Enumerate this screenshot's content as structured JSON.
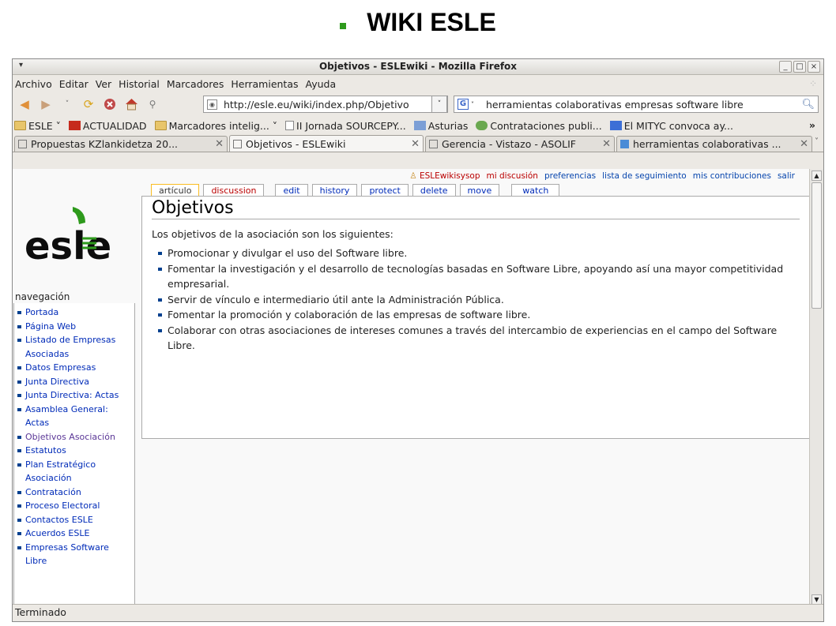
{
  "slide": {
    "title": "WIKI ESLE"
  },
  "window": {
    "title": "Objetivos - ESLEwiki - Mozilla Firefox",
    "controls": {
      "minimize": "_",
      "maximize": "□",
      "close": "×"
    }
  },
  "menubar": [
    "Archivo",
    "Editar",
    "Ver",
    "Historial",
    "Marcadores",
    "Herramientas",
    "Ayuda"
  ],
  "navbar": {
    "url": "http://esle.eu/wiki/index.php/Objetivo",
    "search_value": "herramientas colaborativas empresas software libre"
  },
  "bookmarks": [
    {
      "label": "ESLE ˅",
      "icon": "folder-icon"
    },
    {
      "label": "ACTUALIDAD",
      "icon": "news-icon"
    },
    {
      "label": "Marcadores intelig... ˅",
      "icon": "folder-icon"
    },
    {
      "label": "II Jornada SOURCEPY...",
      "icon": "page-icon"
    },
    {
      "label": "Asturias",
      "icon": "site-icon"
    },
    {
      "label": "Contrataciones publi...",
      "icon": "site-icon"
    },
    {
      "label": "El MITYC convoca ay...",
      "icon": "site-icon"
    }
  ],
  "bookmarks_more": "»",
  "tabs": [
    {
      "label": "Propuestas KZlankidetza 20...",
      "active": false
    },
    {
      "label": "Objetivos - ESLEwiki",
      "active": true
    },
    {
      "label": "Gerencia - Vistazo - ASOLIF",
      "active": false
    },
    {
      "label": "herramientas colaborativas ...",
      "active": false
    }
  ],
  "wiki": {
    "personal": {
      "user": "ESLEwikisysop",
      "talk": "mi discusión",
      "prefs": "preferencias",
      "watchlist": "lista de seguimiento",
      "contribs": "mis contribuciones",
      "logout": "salir"
    },
    "page_tabs": [
      "artículo",
      "discussion",
      "edit",
      "history",
      "protect",
      "delete",
      "move",
      "watch"
    ],
    "logo_text": "esle",
    "nav_title": "navegación",
    "nav_items": [
      "Portada",
      "Página Web",
      "Listado de Empresas Asociadas",
      "Datos Empresas",
      "Junta Directiva",
      "Junta Directiva: Actas",
      "Asamblea General: Actas",
      "Objetivos Asociación",
      "Estatutos",
      "Plan Estratégico Asociación",
      "Contratación",
      "Proceso Electoral",
      "Contactos ESLE",
      "Acuerdos ESLE",
      "Empresas Software Libre"
    ],
    "article": {
      "title": "Objetivos",
      "intro": "Los objetivos de la asociación son los siguientes:",
      "items": [
        "Promocionar y divulgar el uso del Software libre.",
        "Fomentar la investigación y el desarrollo de tecnologías basadas en Software Libre, apoyando así una mayor competitividad empresarial.",
        "Servir de vínculo e intermediario útil ante la Administración Pública.",
        "Fomentar la promoción y colaboración de las empresas de software libre.",
        "Colaborar con otras asociaciones de intereses comunes a través del intercambio de experiencias en el campo del Software Libre."
      ]
    }
  },
  "status": "Terminado"
}
